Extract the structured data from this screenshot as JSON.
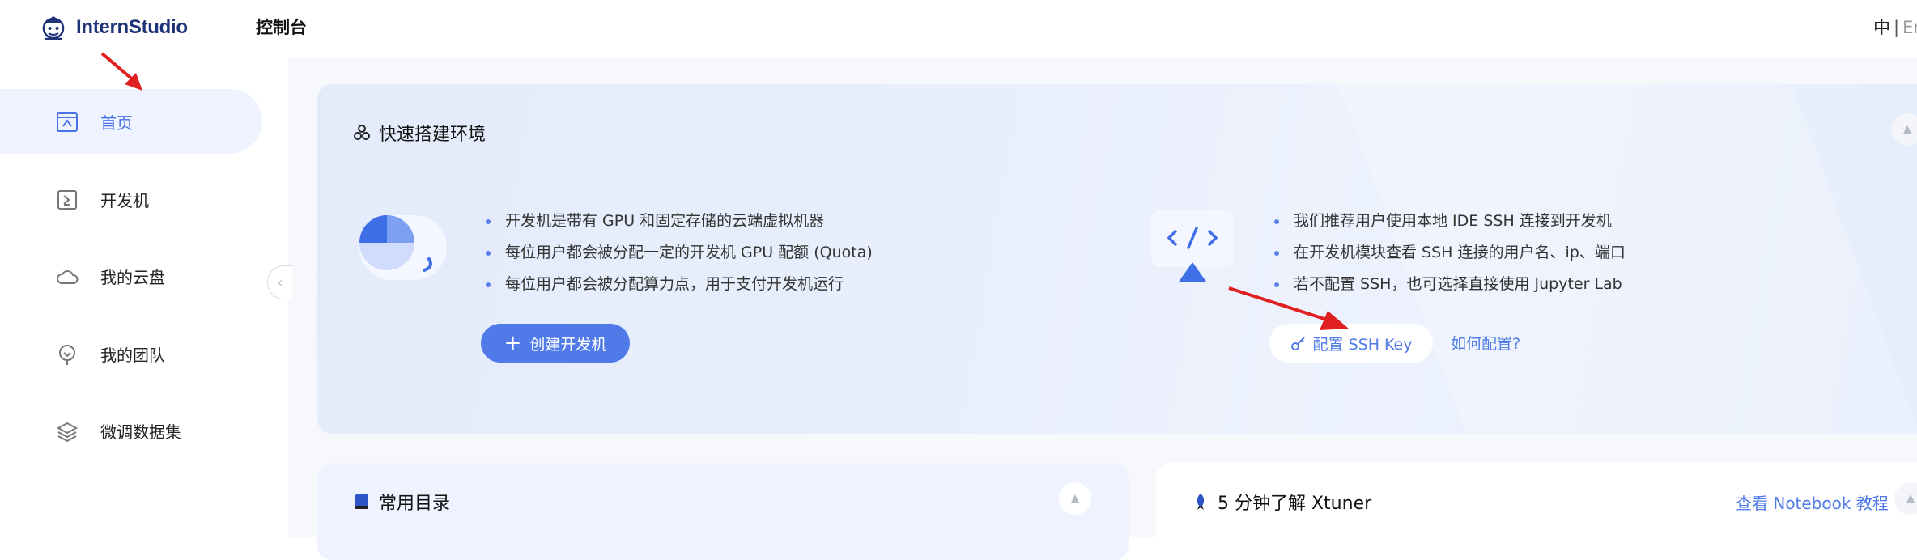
{
  "header": {
    "logo_text": "InternStudio",
    "title": "控制台",
    "lang_zh": "中",
    "lang_sep": "|",
    "lang_en": "En"
  },
  "sidebar": {
    "items": [
      {
        "label": "首页",
        "icon": "home-icon",
        "active": true
      },
      {
        "label": "开发机",
        "icon": "terminal-icon",
        "active": false
      },
      {
        "label": "我的云盘",
        "icon": "cloud-icon",
        "active": false
      },
      {
        "label": "我的团队",
        "icon": "team-icon",
        "active": false
      },
      {
        "label": "微调数据集",
        "icon": "dataset-layers-icon",
        "active": false
      }
    ],
    "collapse_glyph": "‹"
  },
  "quick_setup": {
    "title": "快速搭建环境",
    "left_bullets": [
      "开发机是带有 GPU 和固定存储的云端虚拟机器",
      "每位用户都会被分配一定的开发机 GPU 配额 (Quota)",
      "每位用户都会被分配算力点，用于支付开发机运行"
    ],
    "create_button": "创建开发机",
    "right_bullets": [
      "我们推荐用户使用本地 IDE SSH 连接到开发机",
      "在开发机模块查看 SSH 连接的用户名、ip、端口",
      "若不配置 SSH，也可选择直接使用 Jupyter Lab"
    ],
    "ssh_button": "配置 SSH Key",
    "how_link": "如何配置?"
  },
  "common_dirs": {
    "title": "常用目录"
  },
  "xtuner": {
    "title": "5 分钟了解 Xtuner",
    "link": "查看 Notebook 教程"
  },
  "colors": {
    "accent": "#4f7ae8",
    "active_bg": "#eef3ff",
    "annotation_arrow": "#e02020"
  }
}
